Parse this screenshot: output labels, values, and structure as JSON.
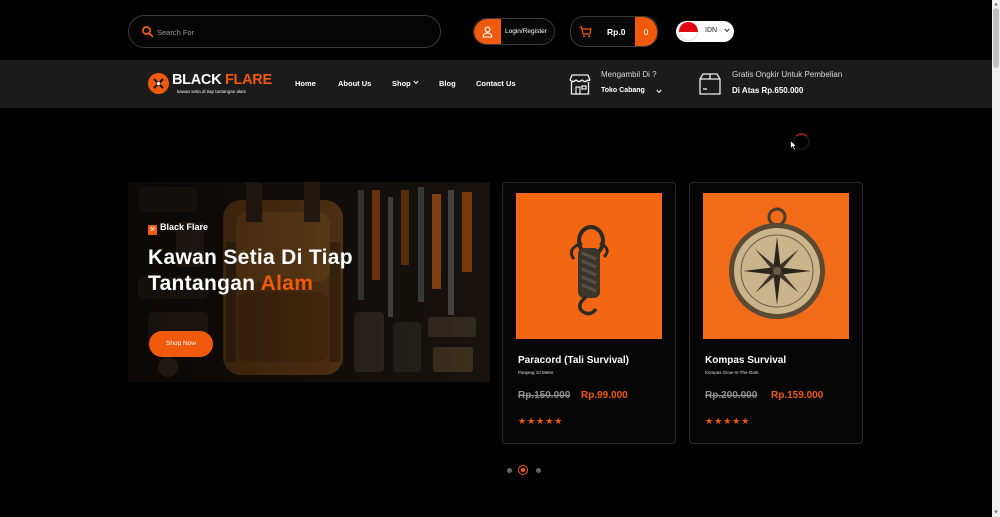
{
  "search": {
    "placeholder": "Search For"
  },
  "account": {
    "login_label": "Login/Register"
  },
  "cart": {
    "total": "Rp.0",
    "count": "0"
  },
  "language": {
    "code": "IDN"
  },
  "logo": {
    "name_part1": "BLACK ",
    "name_part2": "FLARE",
    "tagline": "kawan setia di tiap tantangan alam"
  },
  "nav": {
    "items": [
      {
        "label": "Home"
      },
      {
        "label": "About Us"
      },
      {
        "label": "Shop"
      },
      {
        "label": "Blog"
      },
      {
        "label": "Contact Us"
      }
    ]
  },
  "pickup": {
    "question": "Mengambil Di ?",
    "value": "Toko Cabang"
  },
  "shipping": {
    "line1": "Gratis Ongkir Untuk Pembelian",
    "line2": "Di Atas Rp.650.000"
  },
  "hero": {
    "brand": "Black Flare",
    "title_line1": "Kawan Setia Di Tiap",
    "title_line2a": "Tantangan ",
    "title_line2b": "Alam",
    "button": "Shop Now"
  },
  "products": [
    {
      "name": "Paracord (Tali Survival)",
      "subtitle": "Panjang 10 Meter",
      "old_price": "Rp.150.000",
      "price": "Rp.99.000",
      "rating": 5,
      "stars": "★★★★★"
    },
    {
      "name": "Kompas Survival",
      "subtitle": "Kompas Glow-In-The-Dark",
      "old_price": "Rp.200.000",
      "price": "Rp.159.000",
      "rating": 5,
      "stars": "★★★★★"
    }
  ],
  "carousel": {
    "slides": 3,
    "active": 2
  },
  "colors": {
    "accent": "#f15a0c",
    "background": "#000000",
    "navbar": "#1b1b1b"
  }
}
